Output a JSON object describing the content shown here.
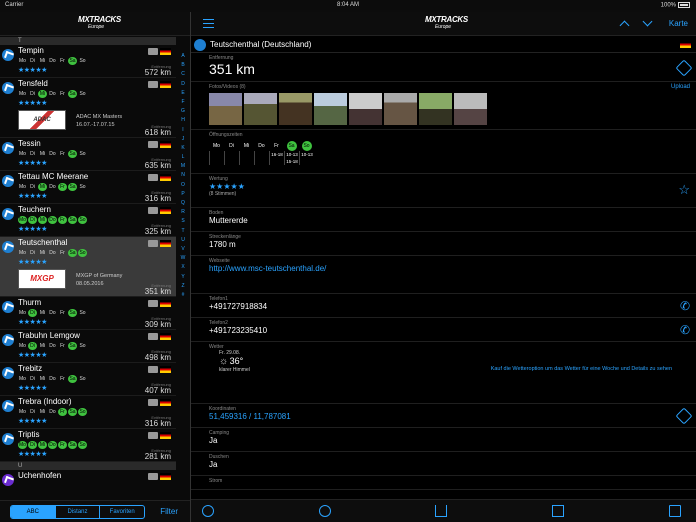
{
  "statusbar": {
    "carrier": "Carrier",
    "time": "8:04 AM",
    "battery": "100%"
  },
  "logo": {
    "line1a": "MX",
    "line1b": "TRACKS",
    "line2": "Europe"
  },
  "left": {
    "section_t": "T",
    "section_u": "U",
    "items": [
      {
        "name": "Tempin",
        "days": [
          "Mo",
          "Di",
          "Mi",
          "Do",
          "Fr",
          "Sa",
          "So"
        ],
        "on": [
          5
        ],
        "stars": "★★★★★",
        "dist_label": "Entfernung",
        "dist": "572 km"
      },
      {
        "name": "Tensfeld",
        "days": [
          "Mo",
          "Di",
          "Mi",
          "Do",
          "Fr",
          "Sa",
          "So"
        ],
        "on": [
          2,
          5
        ],
        "stars": "★★★★★",
        "dist_label": "Entfernung",
        "dist": "618 km",
        "event_logo": "ADAC",
        "event_title": "ADAC MX Masters",
        "event_date": "16.07.-17.07.15"
      },
      {
        "name": "Tessin",
        "days": [
          "Mo",
          "Di",
          "Mi",
          "Do",
          "Fr",
          "Sa",
          "So"
        ],
        "on": [
          5
        ],
        "stars": "★★★★★",
        "dist_label": "Entfernung",
        "dist": "635 km"
      },
      {
        "name": "Tettau MC Meerane",
        "days": [
          "Mo",
          "Di",
          "Mi",
          "Do",
          "Fr",
          "Sa",
          "So"
        ],
        "on": [
          2,
          4,
          5
        ],
        "stars": "★★★★★",
        "dist_label": "Entfernung",
        "dist": "316 km"
      },
      {
        "name": "Teuchern",
        "days": [
          "Mo",
          "Di",
          "Mi",
          "Do",
          "Fr",
          "Sa",
          "So"
        ],
        "on": [
          0,
          1,
          2,
          3,
          4,
          5,
          6
        ],
        "stars": "★★★★★",
        "dist_label": "Entfernung",
        "dist": "325 km"
      },
      {
        "name": "Teutschenthal",
        "days": [
          "Mo",
          "Di",
          "Mi",
          "Do",
          "Fr",
          "Sa",
          "So"
        ],
        "on": [
          5,
          6
        ],
        "stars": "★★★★★",
        "dist_label": "Entfernung",
        "dist": "351 km",
        "event_logo": "MXGP",
        "event_title": "MXGP of Germany",
        "event_date": "08.05.2016",
        "selected": true
      },
      {
        "name": "Thurm",
        "days": [
          "Mo",
          "Di",
          "Mi",
          "Do",
          "Fr",
          "Sa",
          "So"
        ],
        "on": [
          1,
          5
        ],
        "stars": "★★★★★",
        "dist_label": "Entfernung",
        "dist": "309 km"
      },
      {
        "name": "Trabuhn Lemgow",
        "days": [
          "Mo",
          "Di",
          "Mi",
          "Do",
          "Fr",
          "Sa",
          "So"
        ],
        "on": [
          1,
          5
        ],
        "stars": "★★★★★",
        "dist_label": "Entfernung",
        "dist": "498 km"
      },
      {
        "name": "Trebitz",
        "days": [
          "Mo",
          "Di",
          "Mi",
          "Do",
          "Fr",
          "Sa",
          "So"
        ],
        "on": [
          5
        ],
        "stars": "★★★★★",
        "dist_label": "Entfernung",
        "dist": "407 km"
      },
      {
        "name": "Trebra (Indoor)",
        "days": [
          "Mo",
          "Di",
          "Mi",
          "Do",
          "Fr",
          "Sa",
          "So"
        ],
        "on": [
          4,
          5,
          6
        ],
        "stars": "★★★★★",
        "dist_label": "Entfernung",
        "dist": "316 km"
      },
      {
        "name": "Triptis",
        "days": [
          "Mo",
          "Di",
          "Mi",
          "Do",
          "Fr",
          "Sa",
          "So"
        ],
        "on": [
          0,
          1,
          2,
          3,
          4,
          5,
          6
        ],
        "stars": "★★★★★",
        "dist_label": "Entfernung",
        "dist": "281 km"
      },
      {
        "name": "Uchenhofen",
        "days": [
          "Mo",
          "Di",
          "Mi",
          "Do",
          "Fr",
          "Sa",
          "So"
        ],
        "on": [],
        "stars": "",
        "dist_label": "Entfernung",
        "dist": ""
      }
    ],
    "alphabet": [
      "A",
      "B",
      "C",
      "D",
      "E",
      "F",
      "G",
      "H",
      "I",
      "J",
      "K",
      "L",
      "M",
      "N",
      "O",
      "P",
      "Q",
      "R",
      "S",
      "T",
      "U",
      "V",
      "W",
      "X",
      "Y",
      "Z",
      "#"
    ],
    "segments": [
      "ABC",
      "Distanz",
      "Favoriten"
    ],
    "filter": "Filter"
  },
  "right": {
    "karte": "Karte",
    "title": "Teutschenthal (Deutschland)",
    "distance_label": "Entfernung",
    "distance": "351 km",
    "photos_label": "Fotos/Videos (8)",
    "upload": "Upload",
    "hours_label": "Öffnungszeiten",
    "hours": [
      {
        "d": "Mo",
        "on": false,
        "h": ""
      },
      {
        "d": "Di",
        "on": false,
        "h": ""
      },
      {
        "d": "Mi",
        "on": false,
        "h": ""
      },
      {
        "d": "Do",
        "on": false,
        "h": ""
      },
      {
        "d": "Fr",
        "on": false,
        "h": "16-18"
      },
      {
        "d": "Sa",
        "on": true,
        "h": "10-13\n15-18"
      },
      {
        "d": "So",
        "on": true,
        "h": "10-13"
      }
    ],
    "rating_label": "Wertung",
    "rating_stars": "★★★★★",
    "rating_votes": "(8 Stimmen)",
    "soil_label": "Boden",
    "soil": "Muttererde",
    "length_label": "Streckenlänge",
    "length": "1780 m",
    "website_label": "Webseite",
    "website": "http://www.msc-teutschenthal.de/",
    "phone1_label": "Telefon1",
    "phone1": "+491727918834",
    "phone2_label": "Telefon2",
    "phone2": "+491723235410",
    "weather_label": "Wetter",
    "weather_date": "Fr. 29.08.",
    "weather_temp": "36°",
    "weather_desc": "klarer Himmel",
    "weather_msg": "Kauf die Wetteroption um das Wetter für eine Woche und Details zu sehen",
    "coords_label": "Koordinaten",
    "coords": "51,459316 / 11,787081",
    "camping_label": "Camping",
    "camping": "Ja",
    "showers_label": "Duschen",
    "showers": "Ja",
    "power_label": "Strom"
  }
}
